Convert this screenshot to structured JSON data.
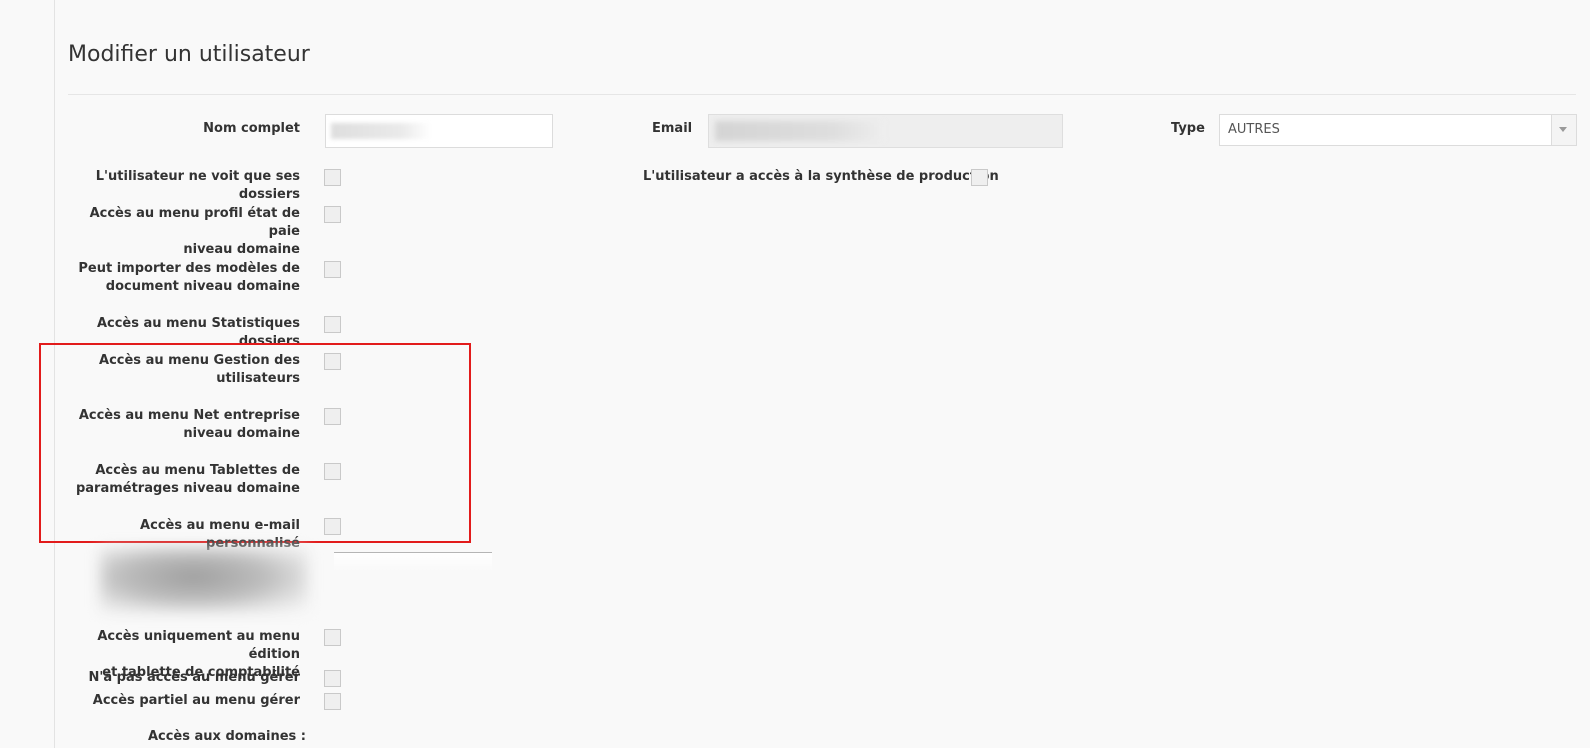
{
  "page": {
    "title": "Modifier un utilisateur"
  },
  "form": {
    "name_label": "Nom complet",
    "email_label": "Email",
    "type_label": "Type",
    "type_value": "AUTRES",
    "synthese_label": "L'utilisateur a accès à la synthèse de production",
    "permissions": [
      {
        "line1": "L'utilisateur ne voit que ses dossiers",
        "line2": ""
      },
      {
        "line1": "Accès au menu profil état de paie",
        "line2": "niveau domaine"
      },
      {
        "line1": "Peut importer des modèles de",
        "line2": "document niveau domaine"
      },
      {
        "line1": "Accès au menu Statistiques dossiers",
        "line2": ""
      },
      {
        "line1": "Accès au menu Gestion des",
        "line2": "utilisateurs"
      },
      {
        "line1": "Accès au menu Net entreprise",
        "line2": "niveau domaine"
      },
      {
        "line1": "Accès au menu Tablettes de",
        "line2": "paramétrages niveau domaine"
      },
      {
        "line1": "Accès au menu e-mail personnalisé",
        "line2": ""
      },
      {
        "line1": "Accès uniquement au menu édition",
        "line2": "et tablette de comptabilité"
      },
      {
        "line1": "N'a pas accès au menu gérer",
        "line2": ""
      },
      {
        "line1": "Accès partiel au menu gérer",
        "line2": ""
      }
    ],
    "domains_label": "Accès aux domaines :"
  },
  "colors": {
    "highlight": "#e21b1b",
    "background": "#f9f9f9"
  }
}
